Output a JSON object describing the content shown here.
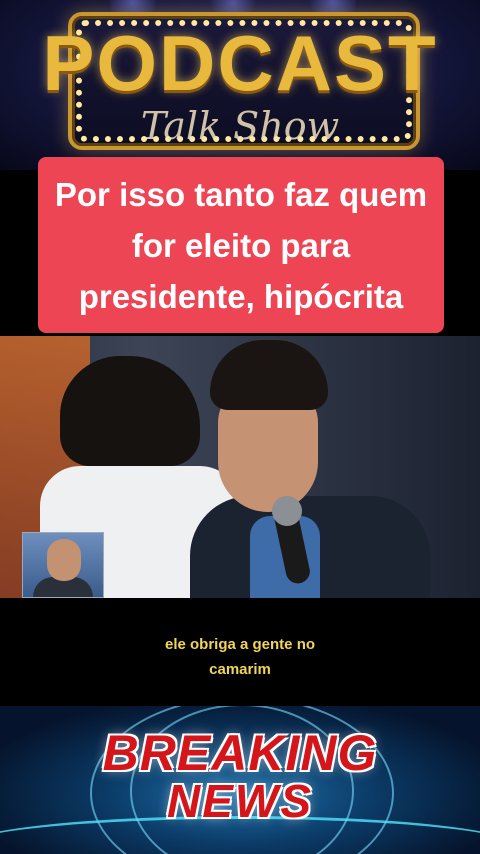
{
  "header_banner": {
    "title": "PODCAST",
    "subtitle": "Talk Show"
  },
  "caption": {
    "text": "Por isso tanto faz quem for eleito para presidente, hipócrita",
    "background_color": "#ee4554"
  },
  "video": {
    "subtitle_line1": "ele obriga a gente no",
    "subtitle_line2": "camarim",
    "subtitle_color": "#f1d45a"
  },
  "footer_banner": {
    "word1": "BREAKING",
    "word2": "NEWS",
    "accent_color": "#d4161b"
  }
}
